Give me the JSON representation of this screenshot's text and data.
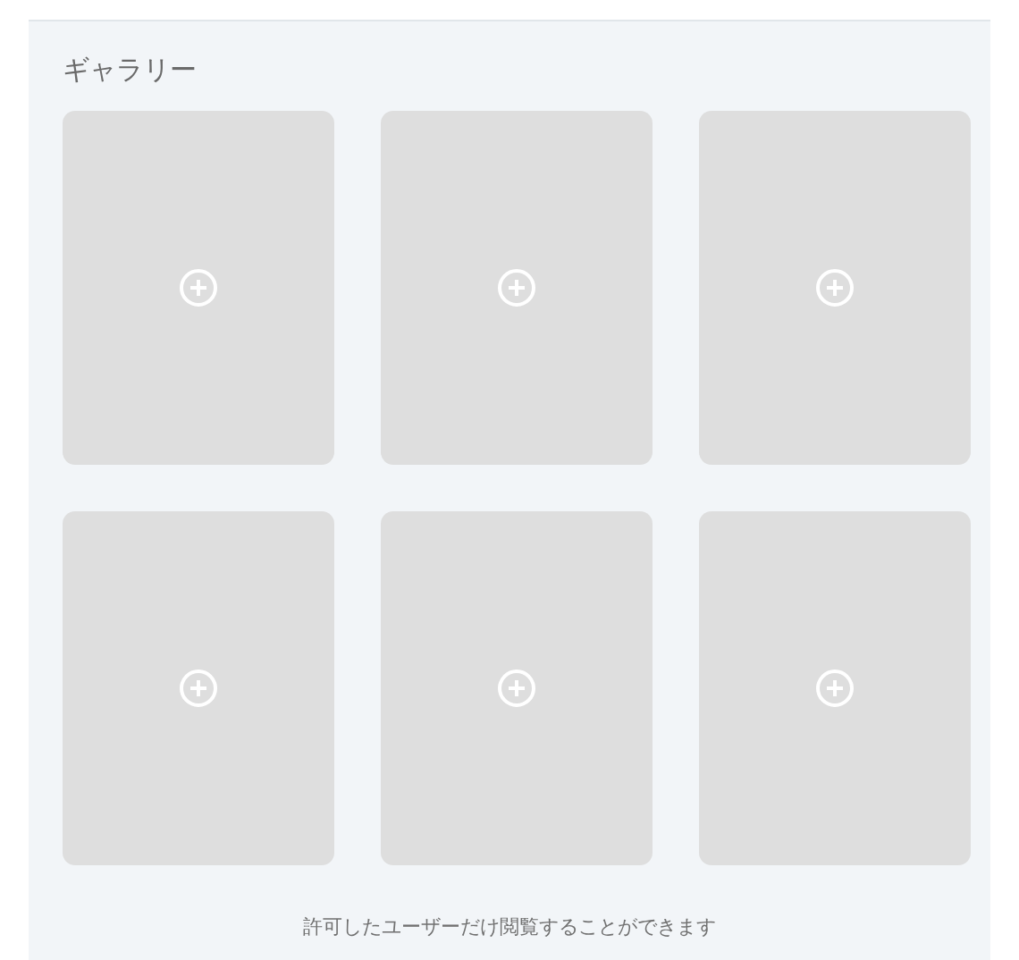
{
  "gallery": {
    "title": "ギャラリー",
    "slots": [
      {
        "kind": "empty"
      },
      {
        "kind": "empty"
      },
      {
        "kind": "empty"
      },
      {
        "kind": "empty"
      },
      {
        "kind": "empty"
      },
      {
        "kind": "empty"
      }
    ],
    "note": "許可したユーザーだけ閲覧することができます"
  }
}
